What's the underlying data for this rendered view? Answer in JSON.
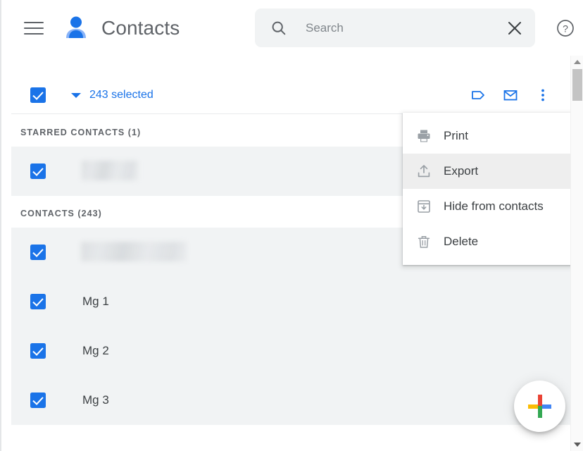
{
  "header": {
    "menu_icon": "hamburger-menu-icon",
    "logo_icon": "contacts-person-icon",
    "title": "Contacts",
    "search": {
      "icon": "search-icon",
      "placeholder": "Search",
      "value": "",
      "clear_icon": "close-x-icon"
    },
    "help_icon": "help-question-circle-icon"
  },
  "selection_toolbar": {
    "select_all_checkbox": "checked",
    "dropdown_caret_icon": "chevron-down-icon",
    "count_label": "243 selected",
    "actions": [
      {
        "name": "manage-labels-button",
        "icon": "label-tag-icon"
      },
      {
        "name": "send-email-button",
        "icon": "envelope-mail-icon"
      },
      {
        "name": "more-actions-button",
        "icon": "more-vertical-dots-icon"
      }
    ],
    "accent_color": "#1a73e8"
  },
  "sections": [
    {
      "heading": "STARRED CONTACTS (1)",
      "rows": [
        {
          "name": "",
          "redacted": true,
          "redacted_width": 80,
          "checked": true
        }
      ]
    },
    {
      "heading": "CONTACTS (243)",
      "rows": [
        {
          "name": "",
          "redacted": true,
          "redacted_width": 150,
          "checked": true
        },
        {
          "name": "Mg 1",
          "redacted": false,
          "checked": true
        },
        {
          "name": "Mg 2",
          "redacted": false,
          "checked": true
        },
        {
          "name": "Mg 3",
          "redacted": false,
          "checked": true
        }
      ]
    }
  ],
  "overflow_menu": {
    "items": [
      {
        "label": "Print",
        "icon": "printer-icon",
        "hovered": false
      },
      {
        "label": "Export",
        "icon": "export-upload-icon",
        "hovered": true
      },
      {
        "label": "Hide from contacts",
        "icon": "hide-archive-icon",
        "hovered": false
      },
      {
        "label": "Delete",
        "icon": "trash-delete-icon",
        "hovered": false
      }
    ]
  },
  "fab": {
    "name": "create-contact-button",
    "icon": "google-plus-icon",
    "colors": {
      "top": "#ea4335",
      "bottom": "#34a853",
      "left": "#fbbc04",
      "right": "#4285f4"
    }
  },
  "scrollbar": {
    "up_arrow_icon": "scroll-up-arrow-icon",
    "down_arrow_icon": "scroll-down-arrow-icon"
  }
}
